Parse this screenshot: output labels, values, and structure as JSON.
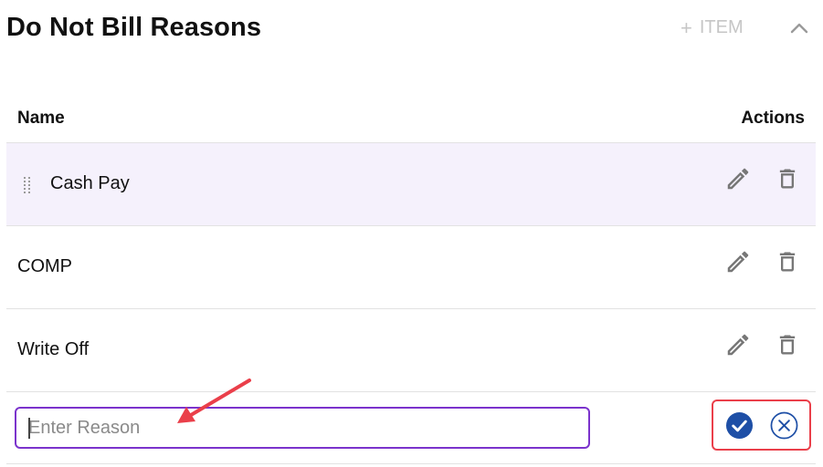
{
  "header": {
    "title": "Do Not Bill Reasons",
    "add_item_label": "ITEM",
    "add_item_plus": "+"
  },
  "table": {
    "columns": {
      "name": "Name",
      "actions": "Actions"
    },
    "rows": [
      {
        "name": "Cash Pay",
        "highlighted": true
      },
      {
        "name": "COMP",
        "highlighted": false
      },
      {
        "name": "Write Off",
        "highlighted": false
      }
    ],
    "new_row": {
      "placeholder": "Enter Reason",
      "value": ""
    }
  },
  "colors": {
    "accent_purple": "#7b33cc",
    "highlight_row": "#f5f1fc",
    "confirm_blue": "#1e4fa6",
    "annotation_red": "#ea3f4a",
    "icon_gray": "#777777",
    "disabled_text": "#c6c6c6"
  },
  "icons": {
    "edit": "pencil-icon",
    "delete": "trash-icon",
    "confirm": "check-circle-icon",
    "cancel": "x-circle-icon",
    "collapse": "chevron-up-icon",
    "drag": "drag-handle-icon"
  }
}
